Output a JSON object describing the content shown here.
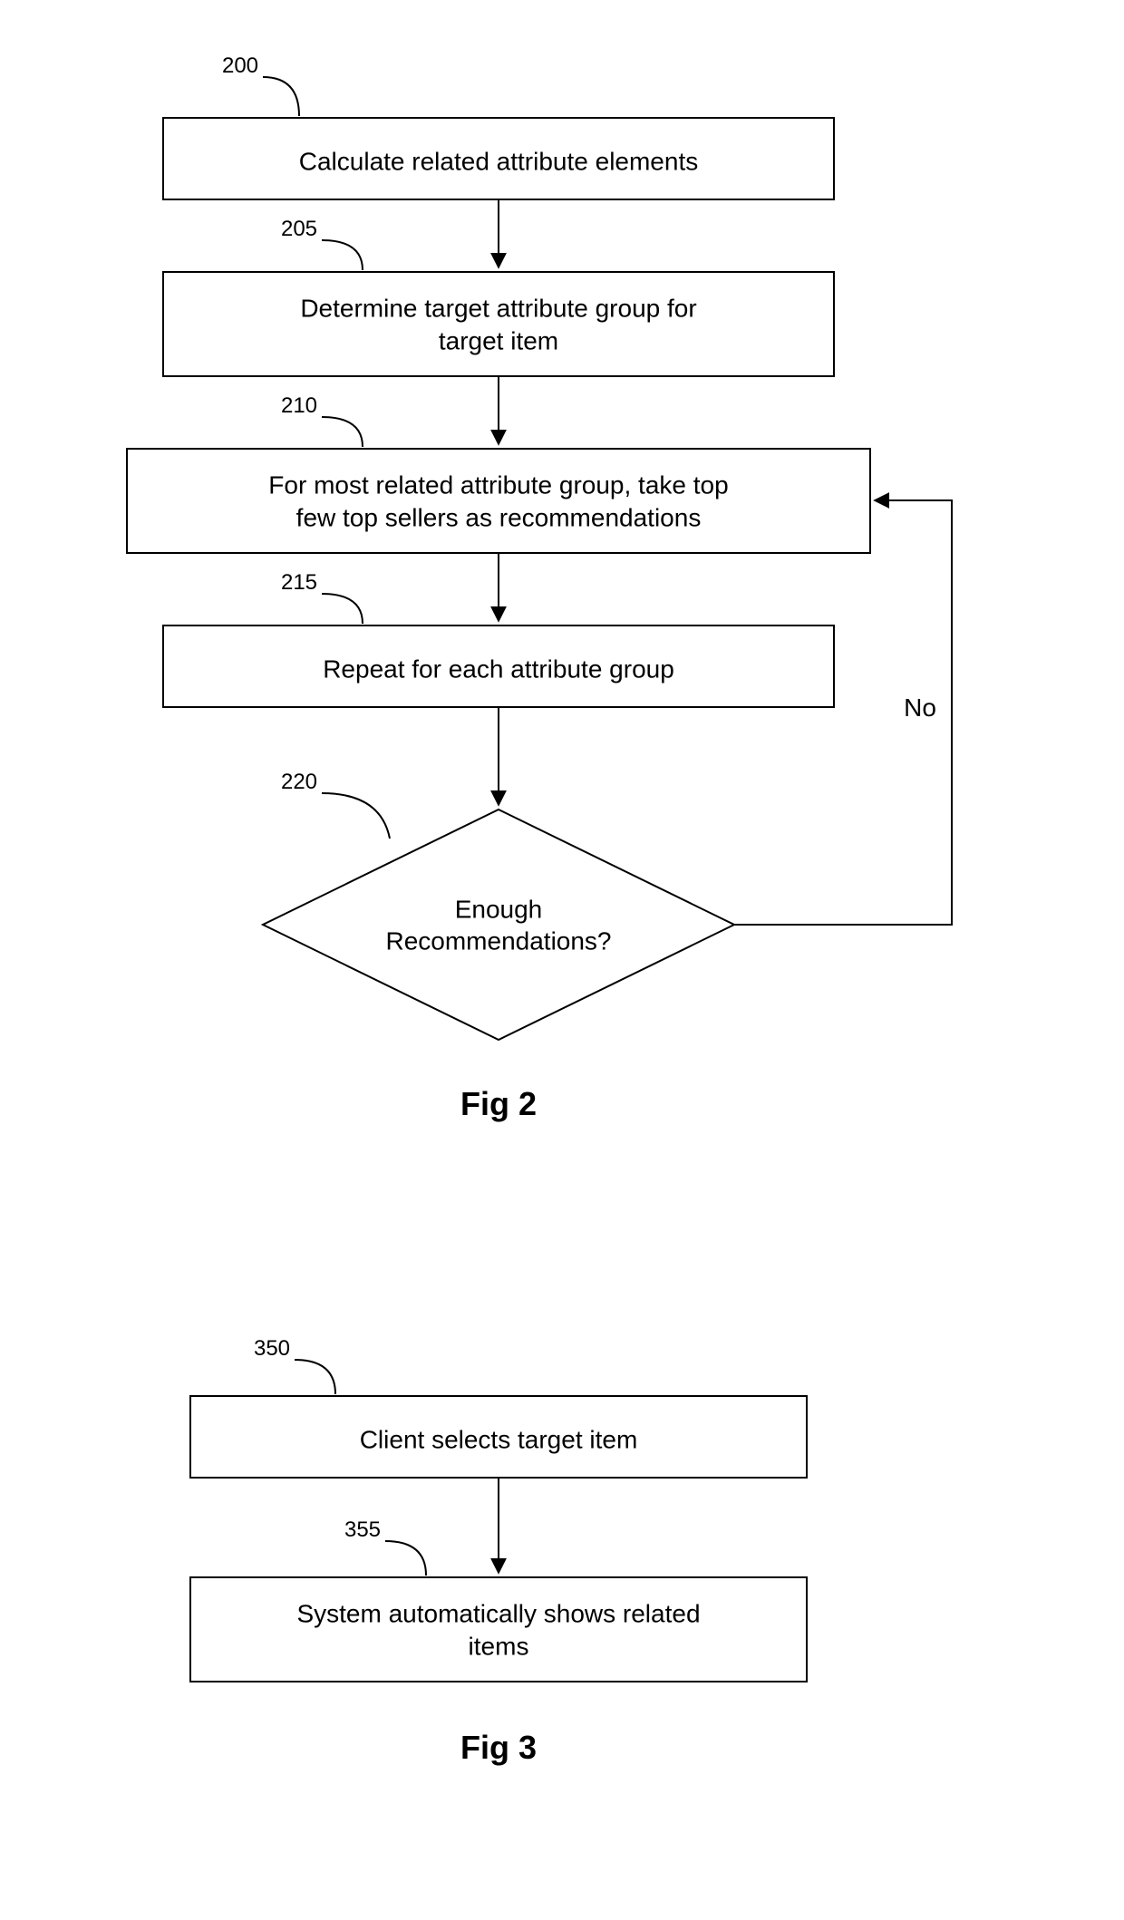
{
  "chart_data": [
    {
      "type": "flowchart",
      "title": "Fig 2",
      "nodes": [
        {
          "id": "200",
          "shape": "rect",
          "text": "Calculate related attribute elements"
        },
        {
          "id": "205",
          "shape": "rect",
          "text": "Determine target attribute group for target item"
        },
        {
          "id": "210",
          "shape": "rect",
          "text": "For most related attribute group, take top few top sellers as recommendations"
        },
        {
          "id": "215",
          "shape": "rect",
          "text": "Repeat for each attribute group"
        },
        {
          "id": "220",
          "shape": "diamond",
          "text": "Enough Recommendations?"
        }
      ],
      "edges": [
        {
          "from": "200",
          "to": "205"
        },
        {
          "from": "205",
          "to": "210"
        },
        {
          "from": "210",
          "to": "215"
        },
        {
          "from": "215",
          "to": "220"
        },
        {
          "from": "220",
          "to": "210",
          "label": "No"
        }
      ]
    },
    {
      "type": "flowchart",
      "title": "Fig 3",
      "nodes": [
        {
          "id": "350",
          "shape": "rect",
          "text": "Client selects target item"
        },
        {
          "id": "355",
          "shape": "rect",
          "text": "System automatically shows related items"
        }
      ],
      "edges": [
        {
          "from": "350",
          "to": "355"
        }
      ]
    }
  ],
  "fig2": {
    "label200": "200",
    "label205": "205",
    "label210": "210",
    "label215": "215",
    "label220": "220",
    "box200": "Calculate related attribute elements",
    "box205_l1": "Determine target attribute group for",
    "box205_l2": "target item",
    "box210_l1": "For most related attribute group, take top",
    "box210_l2": "few top sellers as recommendations",
    "box215": "Repeat for each attribute group",
    "dia220_l1": "Enough",
    "dia220_l2": "Recommendations?",
    "edge_no": "No",
    "caption": "Fig 2"
  },
  "fig3": {
    "label350": "350",
    "label355": "355",
    "box350": "Client selects target item",
    "box355_l1": "System automatically shows related",
    "box355_l2": "items",
    "caption": "Fig 3"
  }
}
